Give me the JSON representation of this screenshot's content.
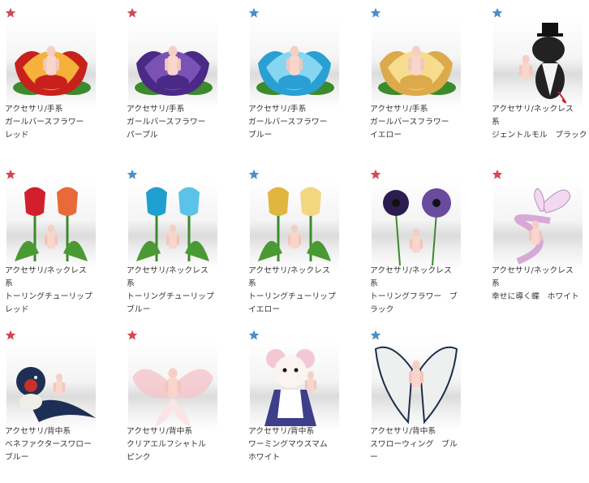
{
  "colors": {
    "star_red": "#d04a55",
    "star_blue": "#4a8ecb"
  },
  "items": [
    {
      "star": "red",
      "category": "アクセサリ/手系",
      "name": "ガールバースフラワー",
      "variant": "レッド",
      "thumb": "flower",
      "c1": "#c8201c",
      "c2": "#f5b13a"
    },
    {
      "star": "red",
      "category": "アクセサリ/手系",
      "name": "ガールバースフラワー",
      "variant": "パープル",
      "thumb": "flower",
      "c1": "#4a2a86",
      "c2": "#7a52b6"
    },
    {
      "star": "blue",
      "category": "アクセサリ/手系",
      "name": "ガールバースフラワー",
      "variant": "ブルー",
      "thumb": "flower",
      "c1": "#2a9fd4",
      "c2": "#86d6f2"
    },
    {
      "star": "blue",
      "category": "アクセサリ/手系",
      "name": "ガールバースフラワー",
      "variant": "イエロー",
      "thumb": "flower",
      "c1": "#dcaa4a",
      "c2": "#f6dc8e"
    },
    {
      "star": "blue",
      "category": "アクセサリ/ネックレス",
      "name": "系",
      "variant": "ジェントルモル　ブラック",
      "thumb": "mole",
      "c1": "#222222",
      "c2": "#cc2233"
    },
    {
      "star": "red",
      "category": "アクセサリ/ネックレス",
      "name": "系",
      "variant": "トーリングチューリップ",
      "variant2": "レッド",
      "thumb": "tulip",
      "c1": "#d21f2c",
      "c2": "#e86a3a"
    },
    {
      "star": "blue",
      "category": "アクセサリ/ネックレス",
      "name": "系",
      "variant": "トーリングチューリップ",
      "variant2": "ブルー",
      "thumb": "tulip",
      "c1": "#1f9fd0",
      "c2": "#5bc3e8"
    },
    {
      "star": "blue",
      "category": "アクセサリ/ネックレス",
      "name": "系",
      "variant": "トーリングチューリップ",
      "variant2": "イエロー",
      "thumb": "tulip",
      "c1": "#e0b540",
      "c2": "#f2d680"
    },
    {
      "star": "red",
      "category": "アクセサリ/ネックレス",
      "name": "系",
      "variant": "トーリングフラワー　ブ",
      "variant2": "ラック",
      "thumb": "anemone",
      "c1": "#2b1d4f",
      "c2": "#6a4a9c"
    },
    {
      "star": "red",
      "category": "アクセサリ/ネックレス",
      "name": "系",
      "variant": "幸せに導く蝶　ホワイト",
      "thumb": "butterfly",
      "c1": "#d8a8d6",
      "c2": "#f3d8ef"
    },
    {
      "star": "red",
      "category": "アクセサリ/背中系",
      "name": "ベネファクタースワロー",
      "variant": "ブルー",
      "thumb": "swallow",
      "c1": "#1e2f55",
      "c2": "#c83028"
    },
    {
      "star": "red",
      "category": "アクセサリ/背中系",
      "name": "クリアエルフシャトル",
      "variant": "ピンク",
      "thumb": "wings",
      "c1": "#f6c6cc",
      "c2": "#fbe4e6"
    },
    {
      "star": "blue",
      "category": "アクセサリ/背中系",
      "name": "ワーミングマウスマム",
      "variant": "ホワイト",
      "thumb": "mouse",
      "c1": "#3d3f8a",
      "c2": "#f2c8d4"
    },
    {
      "star": "blue",
      "category": "アクセサリ/背中系",
      "name": "スワローウィング　ブル",
      "variant": "ー",
      "thumb": "angel",
      "c1": "#1e2e4a",
      "c2": "#eef0f0"
    }
  ]
}
